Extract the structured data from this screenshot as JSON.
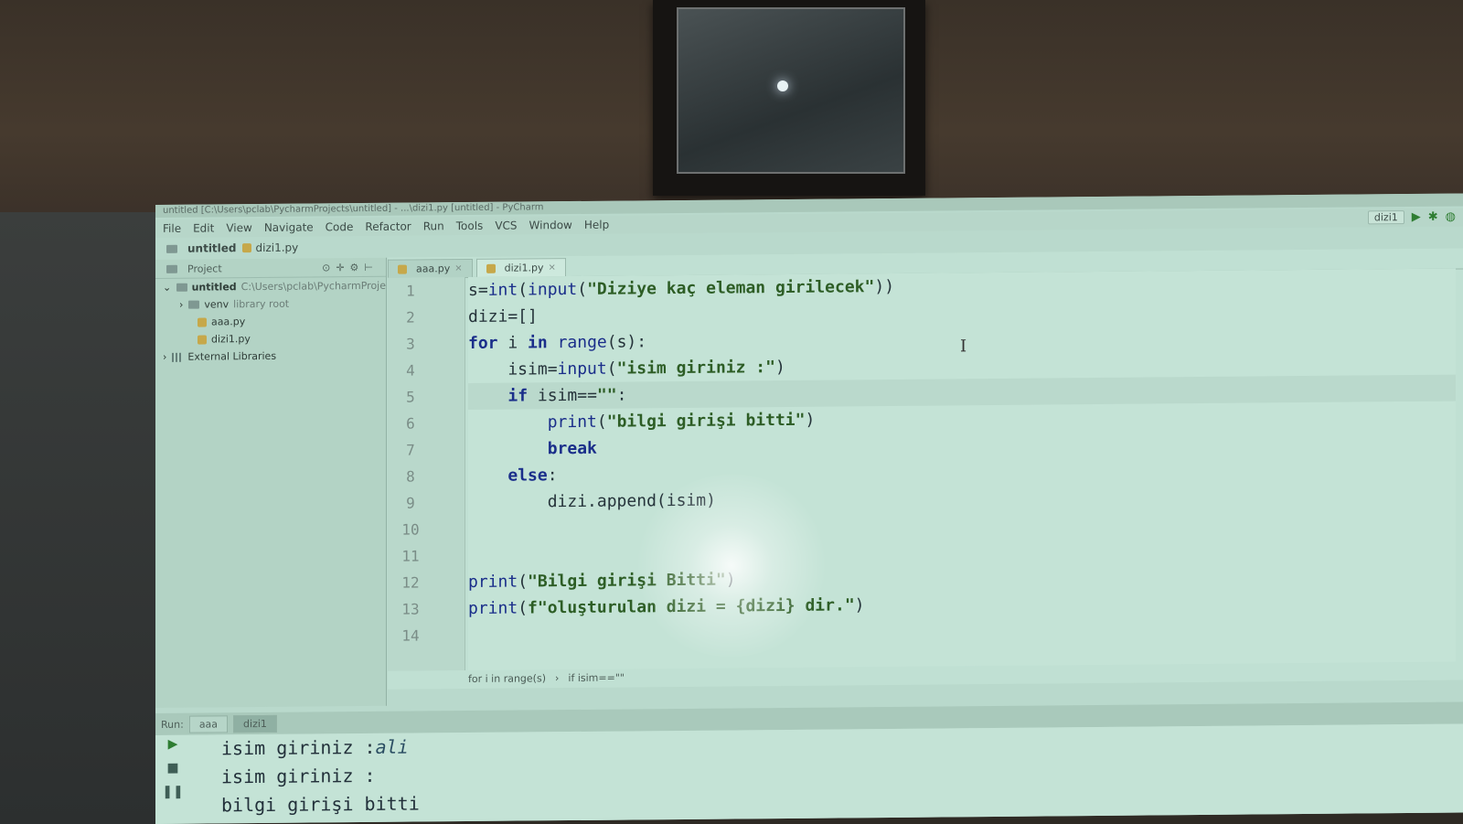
{
  "window": {
    "title": "untitled [C:\\Users\\pclab\\PycharmProjects\\untitled] - ...\\dizi1.py [untitled] - PyCharm"
  },
  "menu": [
    "File",
    "Edit",
    "View",
    "Navigate",
    "Code",
    "Refactor",
    "Run",
    "Tools",
    "VCS",
    "Window",
    "Help"
  ],
  "run_config": {
    "name": "dizi1"
  },
  "breadcrumb": {
    "project": "untitled",
    "file": "dizi1.py"
  },
  "project_pane": {
    "title": "Project",
    "root": {
      "name": "untitled",
      "path": "C:\\Users\\pclab\\PycharmProje"
    },
    "venv": {
      "name": "venv",
      "note": "library root"
    },
    "files": [
      "aaa.py",
      "dizi1.py"
    ],
    "external": "External Libraries"
  },
  "tabs": [
    {
      "label": "aaa.py"
    },
    {
      "label": "dizi1.py"
    }
  ],
  "code_lines": [
    "s=int(input(\"Diziye kaç eleman girilecek\"))",
    "dizi=[]",
    "for i in range(s):",
    "    isim=input(\"isim giriniz :\")",
    "    if isim==\"\":",
    "        print(\"bilgi girişi bitti\")",
    "        break",
    "    else:",
    "        dizi.append(isim)",
    "",
    "",
    "print(\"Bilgi girişi Bitti\")",
    "print(f\"oluşturulan dizi = {dizi} dir.\")",
    ""
  ],
  "line_numbers": [
    "1",
    "2",
    "3",
    "4",
    "5",
    "6",
    "7",
    "8",
    "9",
    "10",
    "11",
    "12",
    "13",
    "14"
  ],
  "editor_breadcrumb": [
    "for i in range(s)",
    "if isim==\"\""
  ],
  "run_panel": {
    "label": "Run:",
    "tabs": [
      "aaa",
      "dizi1"
    ],
    "output": [
      "isim giriniz :ali",
      "isim giriniz :",
      "bilgi girişi bitti"
    ]
  }
}
